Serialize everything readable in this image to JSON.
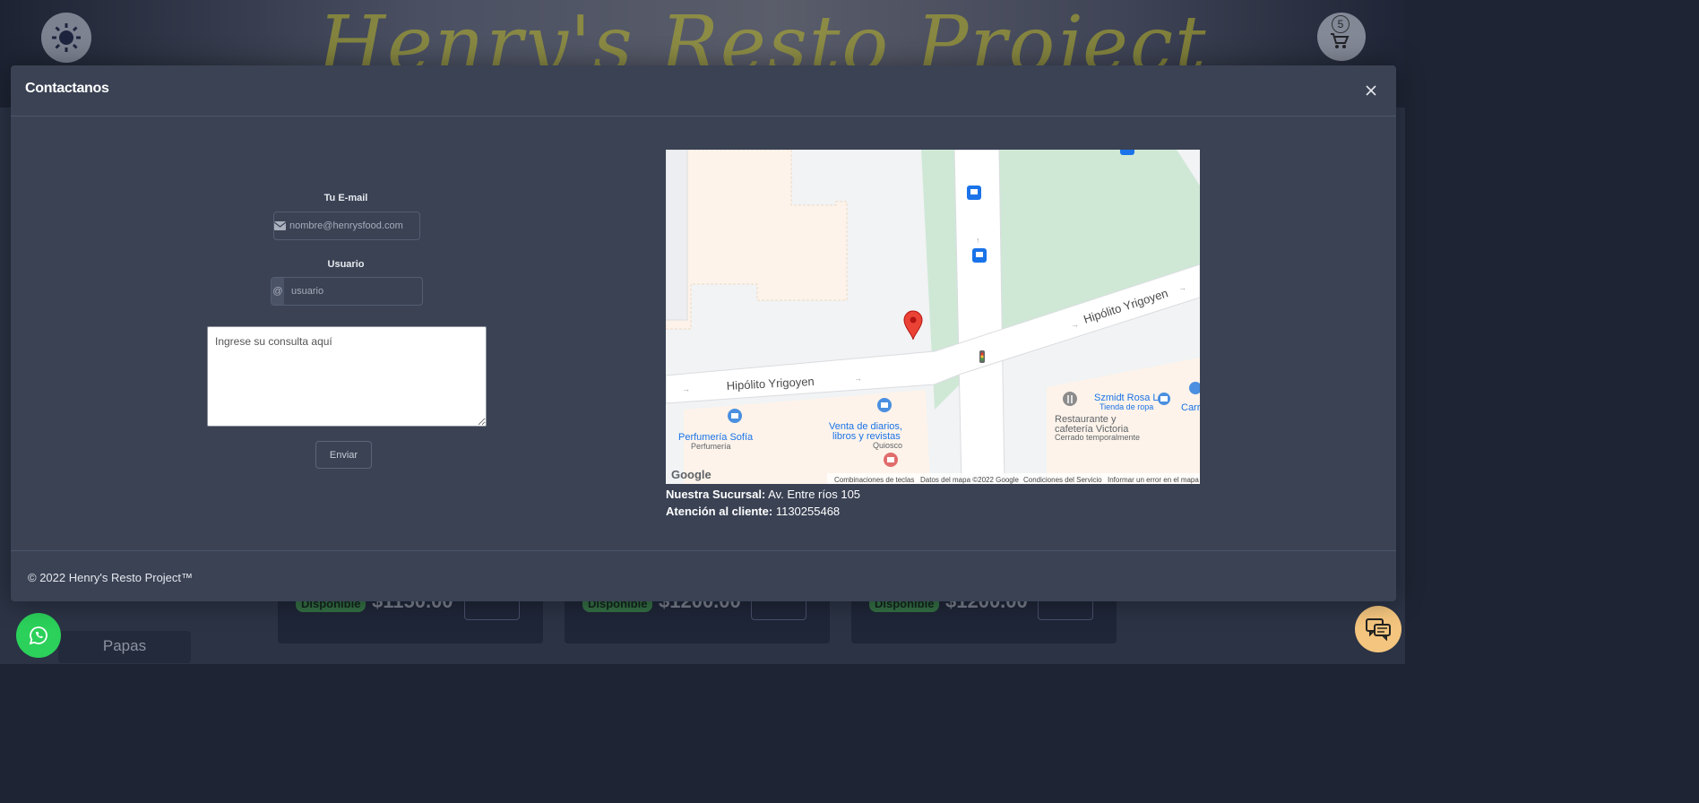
{
  "background": {
    "site_title": "Henry's Resto Project",
    "cart_count": "5",
    "cards": [
      {
        "badge": "Disponible",
        "price": "$1150.00"
      },
      {
        "badge": "Disponible",
        "price": "$1200.00"
      },
      {
        "badge": "Disponible",
        "price": "$1200.00"
      }
    ],
    "sidebar_button": "Papas"
  },
  "modal": {
    "title": "Contactanos",
    "email_label": "Tu E-mail",
    "email_placeholder": "nombre@henrysfood.com",
    "user_label": "Usuario",
    "user_addon": "@",
    "user_placeholder": "usuario",
    "message_placeholder": "Ingrese su consulta aquí",
    "send_label": "Enviar",
    "footer": "© 2022 Henry's Resto Project™"
  },
  "map": {
    "street_1": "Hipólito Yrigoyen",
    "street_2": "Hipólito Yrigoyen",
    "poi_perfumeria": "Perfumería Sofía",
    "poi_perfumeria_cat": "Perfumería",
    "poi_kiosco_1": "Venta de diarios,",
    "poi_kiosco_2": "libros y revistas",
    "poi_kiosco_cat": "Quiosco",
    "poi_rest_1": "Restaurante y",
    "poi_rest_2": "cafetería Victoria",
    "poi_rest_status": "Cerrado temporalmente",
    "poi_shop": "Szmidt Rosa L",
    "poi_shop_cat": "Tienda de ropa",
    "poi_partial": "Carr",
    "google_logo": "Google",
    "attr_keys": "Combinaciones de teclas",
    "attr_data": "Datos del mapa ©2022 Google",
    "attr_terms": "Condiciones del Servicio",
    "attr_report": "Informar un error en el mapa"
  },
  "contact": {
    "branch_label": "Nuestra Sucursal:",
    "branch_value": "Av. Entre ríos 105",
    "support_label": "Atención al cliente:",
    "support_value": "1130255468"
  }
}
